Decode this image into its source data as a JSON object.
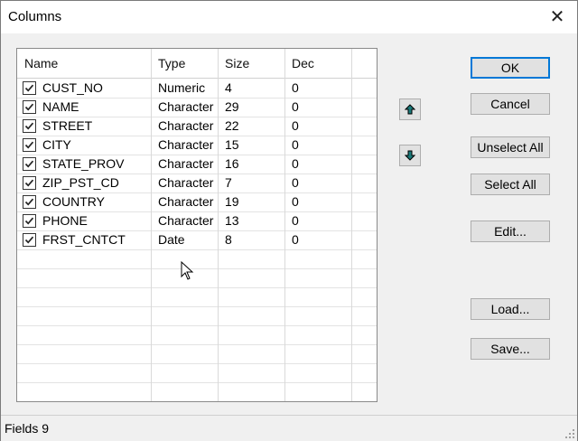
{
  "window": {
    "title": "Columns"
  },
  "grid": {
    "headers": [
      "Name",
      "Type",
      "Size",
      "Dec"
    ],
    "rows": [
      {
        "name": "CUST_NO",
        "type": "Numeric",
        "size": "4",
        "dec": "0",
        "checked": true
      },
      {
        "name": "NAME",
        "type": "Character",
        "size": "29",
        "dec": "0",
        "checked": true
      },
      {
        "name": "STREET",
        "type": "Character",
        "size": "22",
        "dec": "0",
        "checked": true
      },
      {
        "name": "CITY",
        "type": "Character",
        "size": "15",
        "dec": "0",
        "checked": true
      },
      {
        "name": "STATE_PROV",
        "type": "Character",
        "size": "16",
        "dec": "0",
        "checked": true
      },
      {
        "name": "ZIP_PST_CD",
        "type": "Character",
        "size": "7",
        "dec": "0",
        "checked": true
      },
      {
        "name": "COUNTRY",
        "type": "Character",
        "size": "19",
        "dec": "0",
        "checked": true
      },
      {
        "name": "PHONE",
        "type": "Character",
        "size": "13",
        "dec": "0",
        "checked": true
      },
      {
        "name": "FRST_CNTCT",
        "type": "Date",
        "size": "8",
        "dec": "0",
        "checked": true
      }
    ]
  },
  "buttons": {
    "ok": "OK",
    "cancel": "Cancel",
    "unselect_all": "Unselect All",
    "select_all": "Select All",
    "edit": "Edit...",
    "load": "Load...",
    "save": "Save..."
  },
  "icons": {
    "move_up": "arrow-up-icon",
    "move_down": "arrow-down-icon",
    "close": "close-icon"
  },
  "colors": {
    "arrow": "#1a7a7a",
    "default_button_border": "#0078d7"
  },
  "status": {
    "fields_label": "Fields 9"
  }
}
